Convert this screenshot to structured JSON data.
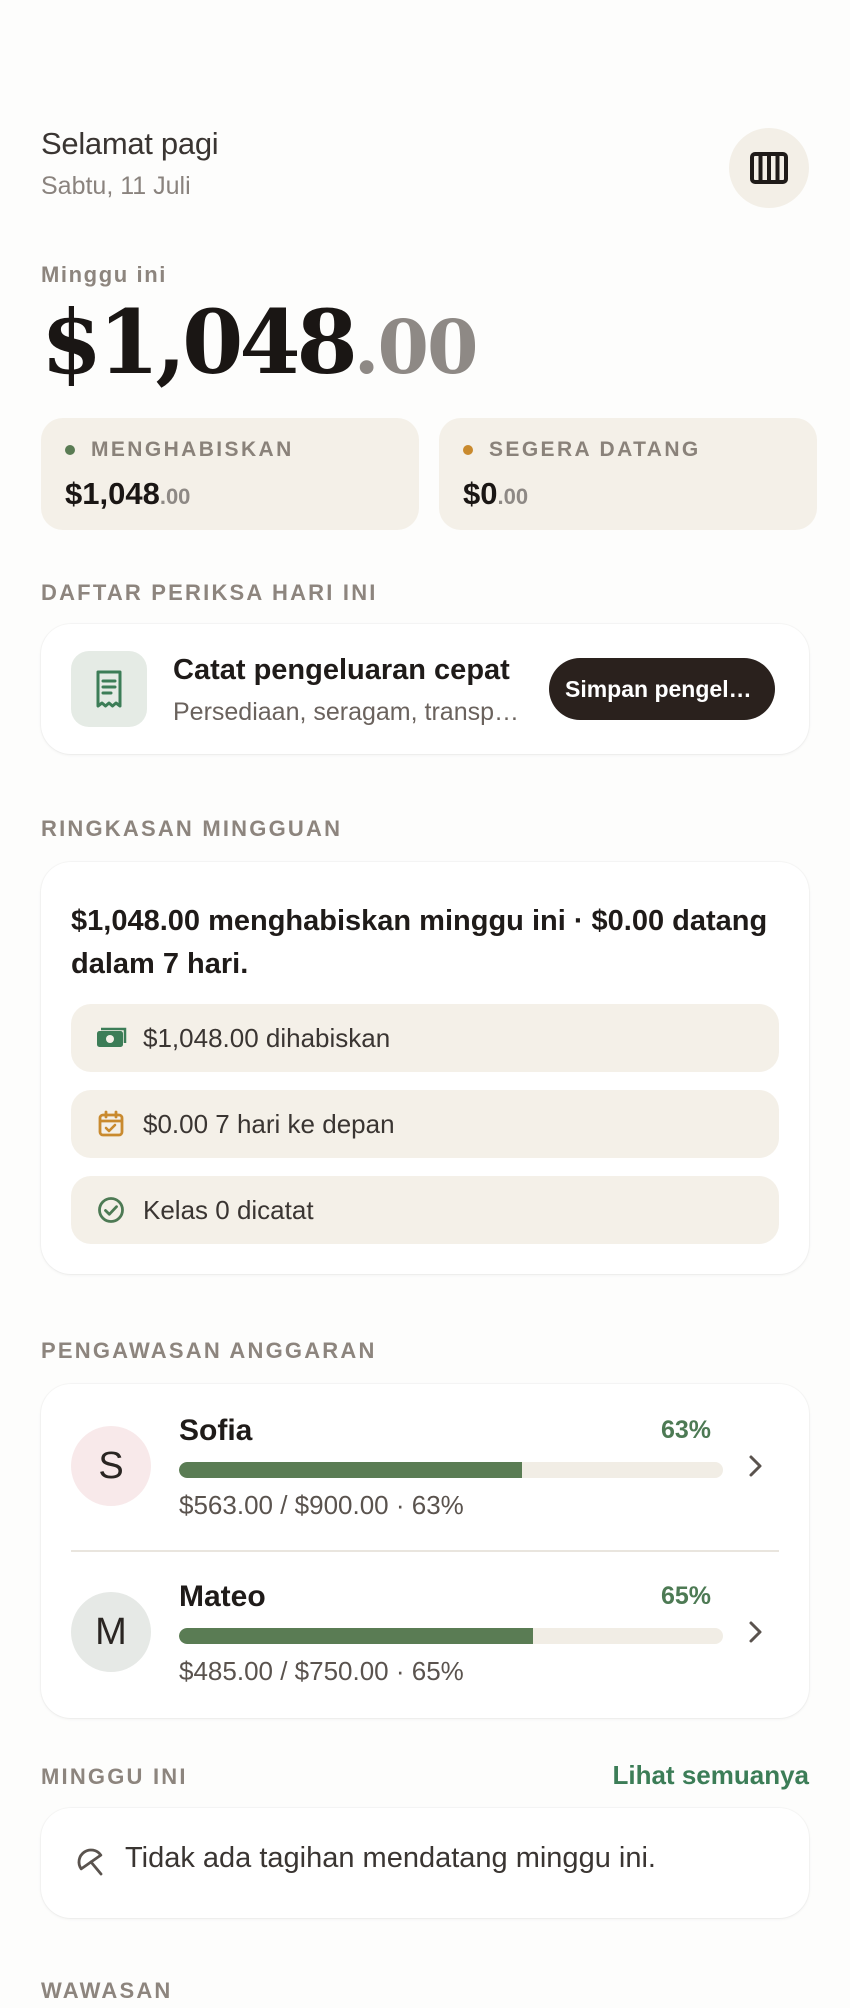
{
  "header": {
    "greeting": "Selamat pagi",
    "date": "Sabtu, 11 Juli",
    "menu_icon": "columns-icon"
  },
  "week": {
    "label": "Minggu ini",
    "amount_main": "$1,048",
    "amount_cents": ".00"
  },
  "stats": {
    "spending": {
      "label": "MENGHABISKAN",
      "main": "$1,048",
      "cents": ".00",
      "dot_color": "#5a7c54"
    },
    "upcoming": {
      "label": "SEGERA DATANG",
      "main": "$0",
      "cents": ".00",
      "dot_color": "#c98a2e"
    }
  },
  "checklist": {
    "label": "DAFTAR PERIKSA HARI INI",
    "icon": "receipt-icon",
    "title": "Catat pengeluaran cepat",
    "subtitle": "Persediaan, seragam, transportasi",
    "button": "Simpan pengeluaran"
  },
  "weekly_summary": {
    "label": "RINGKASAN MINGGUAN",
    "text": "$1,048.00 menghabiskan minggu ini · $0.00 datang dalam 7 hari.",
    "items": [
      {
        "icon": "cash-icon",
        "text": "$1,048.00 dihabiskan"
      },
      {
        "icon": "calendar-check-icon",
        "text": "$0.00 7 hari ke depan"
      },
      {
        "icon": "check-circle-icon",
        "text": "Kelas 0 dicatat"
      }
    ]
  },
  "budget": {
    "label": "PENGAWASAN ANGGARAN",
    "people": [
      {
        "initial": "S",
        "name": "Sofia",
        "percent_label": "63%",
        "progress": 0.63,
        "detail": "$563.00 / $900.00 · 63%",
        "avatar_bg": "#f8e9ea"
      },
      {
        "initial": "M",
        "name": "Mateo",
        "percent_label": "65%",
        "progress": 0.65,
        "detail": "$485.00 / $750.00 · 65%",
        "avatar_bg": "#e6e9e6"
      }
    ]
  },
  "this_week": {
    "label": "MINGGU INI",
    "see_all": "Lihat semuanya",
    "empty_icon": "umbrella-icon",
    "empty_text": "Tidak ada tagihan mendatang minggu ini."
  },
  "insights": {
    "label": "WAWASAN"
  },
  "colors": {
    "accent_green": "#3c7d57",
    "progress_green": "#5a7c54",
    "warm_bg": "#f4f0e8",
    "dark_button": "#2a211d"
  }
}
